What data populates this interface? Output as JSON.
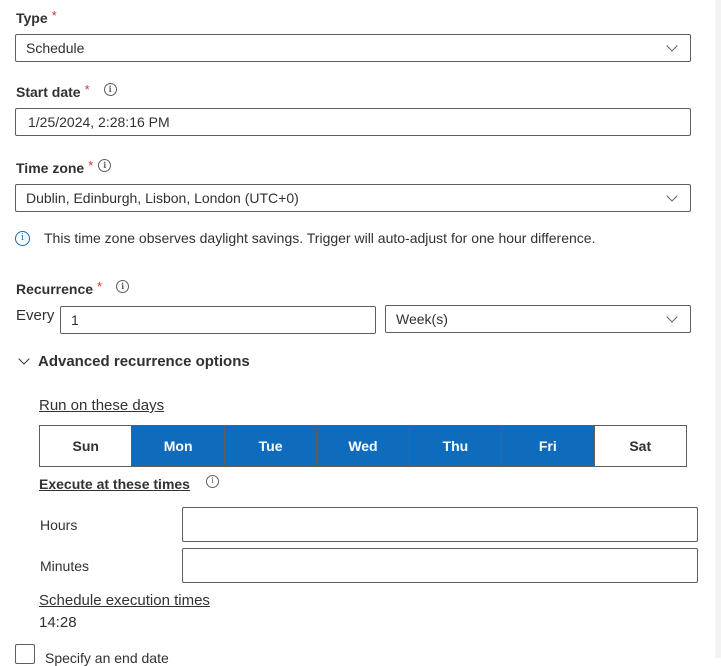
{
  "type": {
    "label": "Type",
    "required_marker": "*",
    "value": "Schedule",
    "icon": "chevron-down-icon"
  },
  "start_date": {
    "label": "Start date",
    "required_marker": "*",
    "info_icon": "i",
    "value": "1/25/2024, 2:28:16 PM"
  },
  "time_zone": {
    "label": "Time zone",
    "required_marker": "*",
    "info_icon": "i",
    "value": "Dublin, Edinburgh, Lisbon, London (UTC+0)",
    "notice": "This time zone observes daylight savings. Trigger will auto-adjust for one hour difference."
  },
  "recurrence": {
    "label": "Recurrence",
    "required_marker": "*",
    "info_icon": "i",
    "every_label": "Every",
    "interval_value": "1",
    "unit_value": "Week(s)"
  },
  "advanced": {
    "toggle_label": "Advanced recurrence options",
    "expanded": true,
    "run_days_label": "Run on these days",
    "days": [
      {
        "label": "Sun",
        "selected": false
      },
      {
        "label": "Mon",
        "selected": true
      },
      {
        "label": "Tue",
        "selected": true
      },
      {
        "label": "Wed",
        "selected": true
      },
      {
        "label": "Thu",
        "selected": true
      },
      {
        "label": "Fri",
        "selected": true
      },
      {
        "label": "Sat",
        "selected": false
      }
    ],
    "execute_times_label": "Execute at these times",
    "hours_label": "Hours",
    "hours_value": "",
    "minutes_label": "Minutes",
    "minutes_value": "",
    "schedule_times_label": "Schedule execution times",
    "schedule_times_value": "14:28"
  },
  "end_date": {
    "label": "Specify an end date",
    "checked": false
  },
  "colors": {
    "accent": "#0f6cbd",
    "required": "#d13438",
    "text": "#323130",
    "border": "#605e5c"
  }
}
